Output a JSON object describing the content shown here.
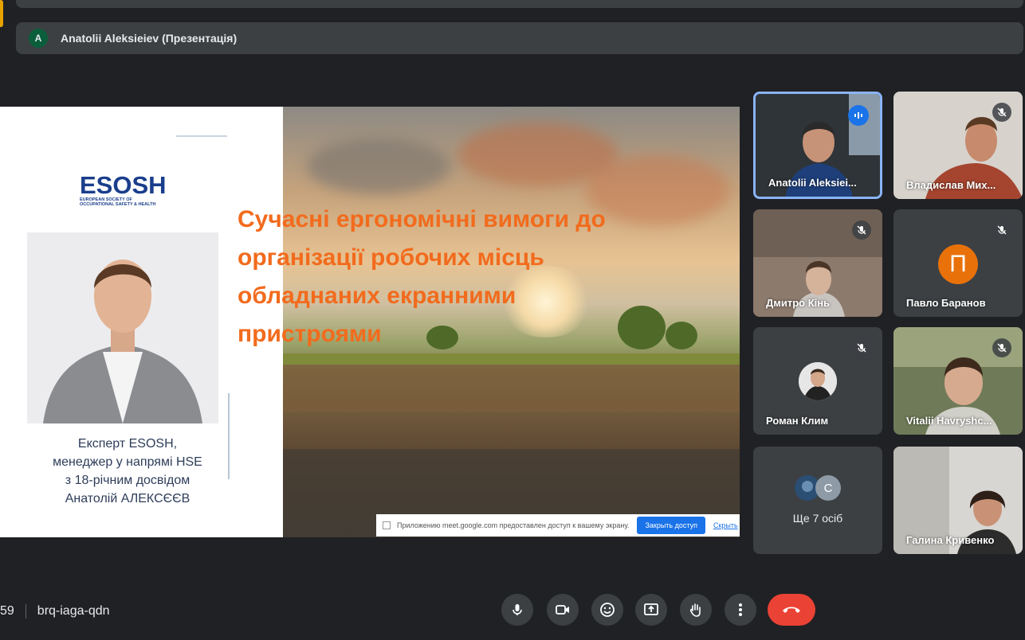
{
  "presenter_bar": {
    "avatar_letter": "A",
    "label": "Anatolii Aleksieiev (Презентація)"
  },
  "slide": {
    "logo_main": "ESOSH",
    "logo_sub_1": "EUROPEAN SOCIETY OF",
    "logo_sub_2": "OCCUPATIONAL SAFETY & HEALTH",
    "caption_lines": [
      "Експерт ESOSH,",
      "менеджер у напрямі HSE",
      "з 18-річним досвідом",
      "Анатолій АЛЕКСЄЄВ"
    ],
    "title_lines": [
      "Сучасні ергономічні вимоги до",
      "організації робочих місць",
      "обладнаних екранними",
      "пристроями"
    ],
    "title_color": "#f26b1d"
  },
  "share_notice": {
    "text": "Приложению meet.google.com предоставлен доступ к вашему экрану.",
    "close_label": "Закрыть доступ",
    "hide_label": "Скрыть"
  },
  "participants": [
    {
      "name": "Anatolii Aleksiei...",
      "speaking": true
    },
    {
      "name": "Владислав Мих...",
      "muted": true
    },
    {
      "name": "Дмитро Кінь",
      "muted": true
    },
    {
      "name": "Павло Баранов",
      "muted": true,
      "avatar_letter": "П"
    },
    {
      "name": "Роман Клим",
      "muted": true
    },
    {
      "name": "Vitalii Havryshc...",
      "muted": true
    },
    {
      "name": "Ще 7 осіб",
      "avatar_letter": "C"
    },
    {
      "name": "Галина Кривенко"
    }
  ],
  "bottom": {
    "time_fragment": "59",
    "meeting_code": "brq-iaga-qdn"
  },
  "colors": {
    "background": "#202124",
    "hangup": "#ea4335",
    "accent": "#1a73e8"
  }
}
